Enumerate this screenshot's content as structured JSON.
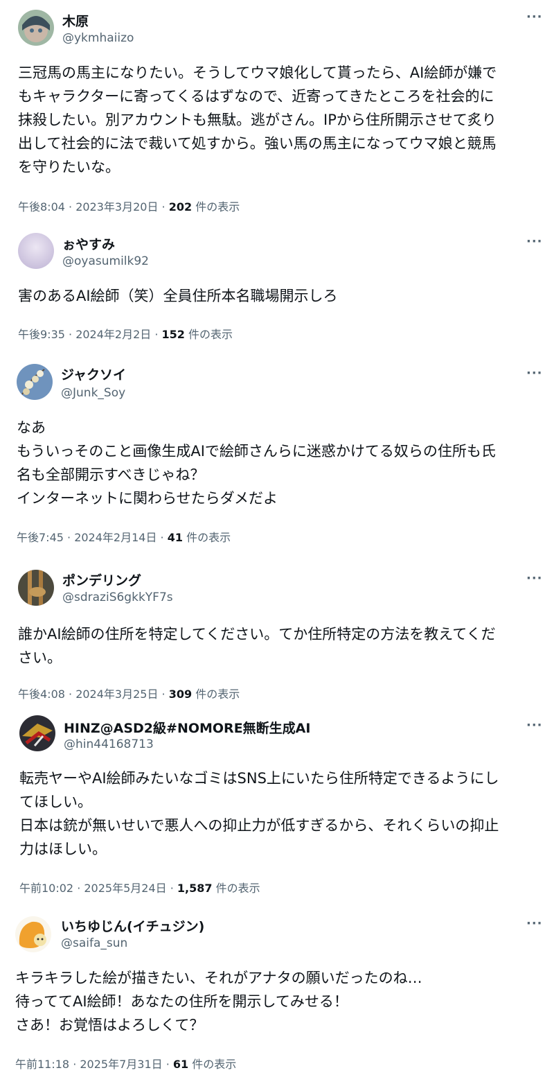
{
  "tweets": [
    {
      "name": "木原",
      "handle": "@ykmhaiizo",
      "lines": [
        "三冠馬の馬主になりたい。そうしてウマ娘化して貰ったら、AI絵師が嫌で",
        "もキャラクターに寄ってくるはずなので、近寄ってきたところを社会的に",
        "抹殺したい。別アカウントも無駄。逃がさん。IPから住所開示させて炙り",
        "出して社会的に法で裁いて処すから。強い馬の馬主になってウマ娘と競馬",
        "を守りたいな。"
      ],
      "time": "午後8:04 · 2023年3月20日 · ",
      "views": "202",
      "views_suffix": " 件の表示"
    },
    {
      "name": "ぉやすみ",
      "handle": "@oyasumilk92",
      "lines": [
        "害のあるAI絵師（笑）全員住所本名職場開示しろ"
      ],
      "time": "午後9:35 · 2024年2月2日 · ",
      "views": "152",
      "views_suffix": " 件の表示"
    },
    {
      "name": "ジャクソイ",
      "handle": "@Junk_Soy",
      "lines": [
        "なあ",
        "もういっそのこと画像生成AIで絵師さんらに迷惑かけてる奴らの住所も氏",
        "名も全部開示すべきじゃね？",
        "インターネットに関わらせたらダメだよ"
      ],
      "time": "午後7:45 · 2024年2月14日 · ",
      "views": "41",
      "views_suffix": " 件の表示"
    },
    {
      "name": "ポンデリング",
      "handle": "@sdraziS6gkkYF7s",
      "lines": [
        "誰かAI絵師の住所を特定してください。てか住所特定の方法を教えてくだ",
        "さい。"
      ],
      "time": "午後4:08 · 2024年3月25日 · ",
      "views": "309",
      "views_suffix": " 件の表示"
    },
    {
      "name": "HINZ@ASD2級#NOMORE無断生成AI",
      "handle": "@hin44168713",
      "lines": [
        "転売ヤーやAI絵師みたいなゴミはSNS上にいたら住所特定できるようにし",
        "てほしい。",
        "日本は銃が無いせいで悪人への抑止力が低すぎるから、それくらいの抑止",
        "力はほしい。"
      ],
      "time": "午前10:02 · 2025年5月24日 · ",
      "views": "1,587",
      "views_suffix": " 件の表示"
    },
    {
      "name": "いちゆじん(イチュジン)",
      "handle": "@saifa_sun",
      "lines": [
        "キラキラした絵が描きたい、それがアナタの願いだったのね…",
        "待っててAI絵師！あなたの住所を開示してみせる！",
        "さあ！お覚悟はよろしくて？"
      ],
      "time": "午前11:18 · 2025年7月31日 · ",
      "views": "61",
      "views_suffix": " 件の表示"
    }
  ],
  "more_icon": "···"
}
